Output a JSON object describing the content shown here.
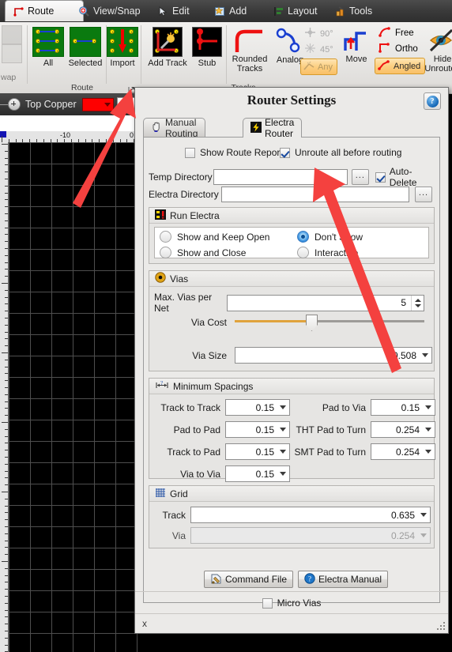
{
  "ribbon": {
    "tabs": [
      {
        "label": "Route",
        "icon": "route-icon",
        "active": true
      },
      {
        "label": "View/Snap",
        "icon": "magnifier-plus-icon",
        "active": false
      },
      {
        "label": "Edit",
        "icon": "cursor-arrow-icon",
        "active": false
      },
      {
        "label": "Add",
        "icon": "add-star-icon",
        "active": false
      },
      {
        "label": "Layout",
        "icon": "layout-align-icon",
        "active": false
      },
      {
        "label": "Tools",
        "icon": "tools-icon",
        "active": false
      }
    ],
    "groups": [
      {
        "name": "Route",
        "label": "Route",
        "buttons": [
          {
            "label": "All",
            "icon": "pcb-all-icon"
          },
          {
            "label": "Selected",
            "icon": "pcb-selected-icon"
          },
          {
            "label": "Import",
            "icon": "pcb-import-icon"
          }
        ],
        "dialog_launcher": "dialog-launcher-icon"
      },
      {
        "name": "Tracks",
        "label": "Tracks",
        "buttons": [
          {
            "label": "Add Track",
            "icon": "add-track-icon"
          },
          {
            "label": "Stub",
            "icon": "stub-icon"
          },
          {
            "label": "Rounded Tracks",
            "icon": "rounded-track-icon"
          },
          {
            "label": "Analog",
            "icon": "analog-track-icon"
          },
          {
            "label": "Move",
            "icon": "move-track-icon"
          },
          {
            "label": "Hide Unrouted",
            "icon": "hide-unrouted-eye-icon"
          }
        ],
        "angle_toggles": [
          {
            "label": "90°",
            "state": "off",
            "icon": "angle-90-icon"
          },
          {
            "label": "45°",
            "state": "off",
            "icon": "angle-45-icon"
          },
          {
            "label": "Any",
            "state": "off-highlight",
            "icon": "angle-any-icon"
          }
        ],
        "mode_toggles": [
          {
            "label": "Free",
            "state": "off",
            "icon": "free-track-icon"
          },
          {
            "label": "Ortho",
            "state": "off",
            "icon": "ortho-track-icon"
          },
          {
            "label": "Angled",
            "state": "on",
            "icon": "angled-track-icon"
          }
        ]
      }
    ]
  },
  "editor": {
    "layer_name": "Top Copper",
    "layer_color": "#fe0000",
    "ruler_labels": [
      "-10",
      "0"
    ],
    "canvas_bg": "#000000",
    "grid_color": "#4e4e4e"
  },
  "dialog": {
    "title": "Router Settings",
    "help_icon": "help-question-icon",
    "tabs": [
      {
        "label": "Manual Routing",
        "icon": "hand-icon",
        "active": false
      },
      {
        "label": "Electra Router",
        "icon": "lightning-bolt-icon",
        "active": true
      }
    ],
    "options": {
      "show_route_report": {
        "label": "Show Route Report",
        "checked": false
      },
      "unroute_all": {
        "label": "Unroute all before routing",
        "checked": true
      }
    },
    "temp_directory": {
      "label": "Temp Directory",
      "value": "",
      "browse": "...",
      "auto_delete": {
        "label": "Auto-Delete",
        "checked": true
      }
    },
    "electra_directory": {
      "label": "Electra Directory",
      "value": "",
      "browse": "..."
    },
    "run_electra": {
      "title": "Run Electra",
      "icon": "run-electra-icon",
      "options": [
        {
          "label": "Show and Keep Open",
          "selected": false
        },
        {
          "label": "Don't Show",
          "selected": true
        },
        {
          "label": "Show and Close",
          "selected": false
        },
        {
          "label": "Interactive",
          "selected": false
        }
      ]
    },
    "vias": {
      "title": "Vias",
      "icon": "via-icon",
      "max_vias_label": "Max. Vias per Net",
      "max_vias_value": "5",
      "via_cost_label": "Via Cost",
      "via_cost_percent": 40,
      "via_size_label": "Via Size",
      "via_size_value": "0.508"
    },
    "minimum_spacings": {
      "title": "Minimum Spacings",
      "icon": "spacing-measure-icon",
      "left": [
        {
          "label": "Track to Track",
          "value": "0.15"
        },
        {
          "label": "Pad to Pad",
          "value": "0.15"
        },
        {
          "label": "Track to Pad",
          "value": "0.15"
        },
        {
          "label": "Via to Via",
          "value": "0.15"
        }
      ],
      "right": [
        {
          "label": "Pad to Via",
          "value": "0.15"
        },
        {
          "label": "THT Pad to Turn",
          "value": "0.254"
        },
        {
          "label": "SMT Pad to Turn",
          "value": "0.254"
        }
      ]
    },
    "grid": {
      "title": "Grid",
      "icon": "grid-icon",
      "track_label": "Track",
      "track_value": "0.635",
      "via_label": "Via",
      "via_value": "0.254",
      "via_disabled": true
    },
    "buttons": [
      {
        "label": "Command File",
        "icon": "command-file-icon"
      },
      {
        "label": "Electra Manual",
        "icon": "manual-help-icon"
      }
    ],
    "micro_vias": {
      "label": "Micro Vias",
      "checked": false
    },
    "status_close": "x",
    "resize_grip": "resize-grip-icon"
  },
  "annotations": {
    "arrow_color": "#f4413f",
    "arrows": [
      {
        "name": "arrow-to-dialog-launcher"
      },
      {
        "name": "arrow-to-electra-directory"
      }
    ]
  }
}
